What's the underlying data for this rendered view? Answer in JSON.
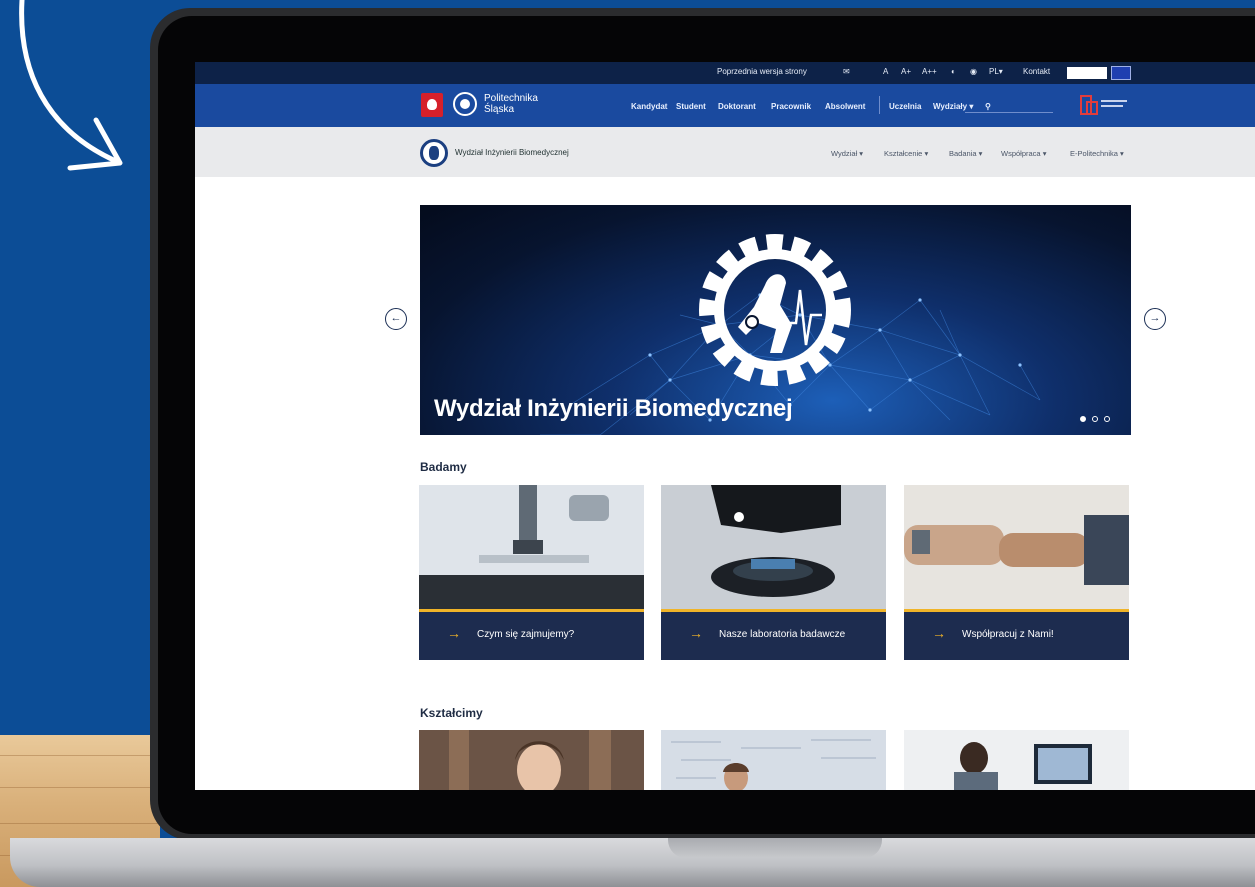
{
  "utility_bar": {
    "prev_version": "Poprzednia wersja strony",
    "font_small": "A",
    "font_medium": "A+",
    "font_large": "A++",
    "language": "PL",
    "contact": "Kontakt"
  },
  "main_nav": {
    "brand_line1": "Politechnika",
    "brand_line2": "Śląska",
    "links": [
      "Kandydat",
      "Student",
      "Doktorant",
      "Pracownik",
      "Absolwent"
    ],
    "uczelnia": "Uczelnia",
    "wydzialy": "Wydziały"
  },
  "faculty_bar": {
    "name": "Wydział Inżynierii Biomedycznej",
    "nav": [
      "Wydział",
      "Kształcenie",
      "Badania",
      "Współpraca",
      "E-Politechnika"
    ]
  },
  "hero": {
    "title": "Wydział Inżynierii Biomedycznej",
    "slides": 3,
    "active_slide": 1
  },
  "sections": [
    {
      "title": "Badamy",
      "cards": [
        {
          "label": "Czym się zajmujemy?",
          "image_icon": "microscope-image"
        },
        {
          "label": "Nasze laboratoria badawcze",
          "image_icon": "lab-device-image"
        },
        {
          "label": "Współpracuj z Nami!",
          "image_icon": "fist-bump-image"
        }
      ]
    },
    {
      "title": "Kształcimy",
      "cards": [
        {
          "image_icon": "student-portrait-image"
        },
        {
          "image_icon": "whiteboard-image"
        },
        {
          "image_icon": "computer-work-image"
        }
      ]
    }
  ],
  "colors": {
    "background": "#0c4d96",
    "utility_bar": "#0d2248",
    "main_nav": "#1a4a9f",
    "card": "#1d2c4f",
    "accent": "#f0b428"
  }
}
